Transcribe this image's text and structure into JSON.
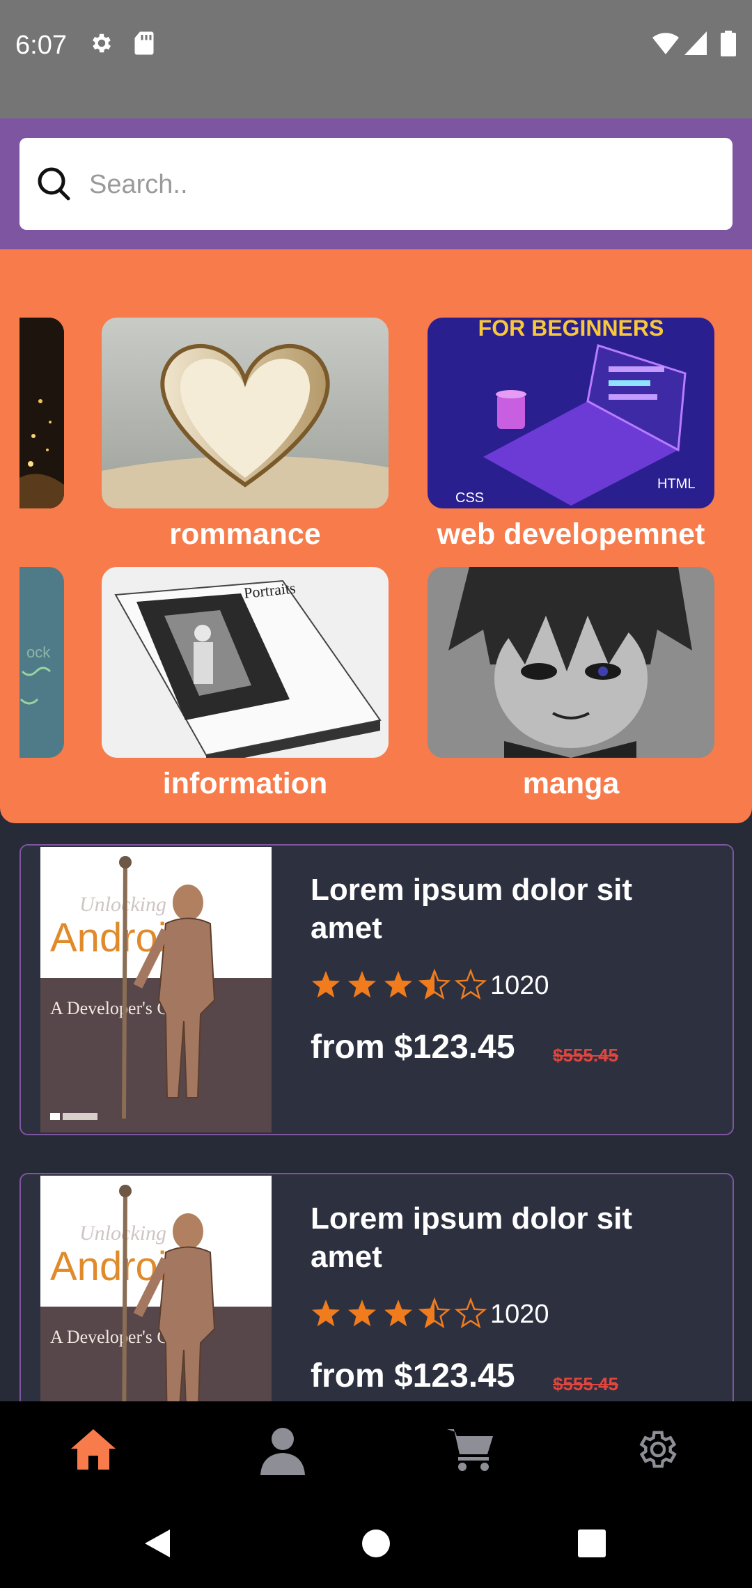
{
  "status_bar": {
    "time": "6:07",
    "icons": [
      "settings-icon",
      "sd-card-icon",
      "wifi-icon",
      "signal-icon",
      "battery-icon"
    ]
  },
  "search": {
    "placeholder": "Search..",
    "value": ""
  },
  "categories": [
    {
      "label": "rommance",
      "image": "heart-book-photo"
    },
    {
      "label": "web developemnet",
      "image": "for-beginners-laptop-illustration",
      "image_text": "FOR BEGINNERS"
    },
    {
      "label": "information",
      "image": "portraits-book-photo",
      "image_text": "Portraits"
    },
    {
      "label": "manga",
      "image": "manga-character-drawing"
    }
  ],
  "books": [
    {
      "cover_title": "Unlocking",
      "cover_subject": "Android",
      "cover_subtitle": "A Developer's Guide",
      "title": "Lorem ipsum dolor sit amet",
      "rating": 3.5,
      "rating_max": 5,
      "rating_count": "1020",
      "price": "from $123.45",
      "old_price": "$555.45"
    },
    {
      "cover_title": "Unlocking",
      "cover_subject": "Android",
      "cover_subtitle": "A Developer's Guide",
      "title": "Lorem ipsum dolor sit amet",
      "rating": 3.5,
      "rating_max": 5,
      "rating_count": "1020",
      "price": "from $123.45",
      "old_price": "$555.45"
    }
  ],
  "bottom_nav": {
    "items": [
      "home-icon",
      "person-icon",
      "cart-icon",
      "gear-icon"
    ],
    "active": "home-icon"
  },
  "colors": {
    "status_bar": "#757575",
    "search_band": "#7e55a1",
    "category_panel": "#f77b4b",
    "background": "#272a37",
    "card": "#2d303f",
    "accent": "#f77b4b",
    "star": "#f07c1e",
    "old_price": "#e0463f",
    "nav_inactive": "#8d8e96"
  }
}
